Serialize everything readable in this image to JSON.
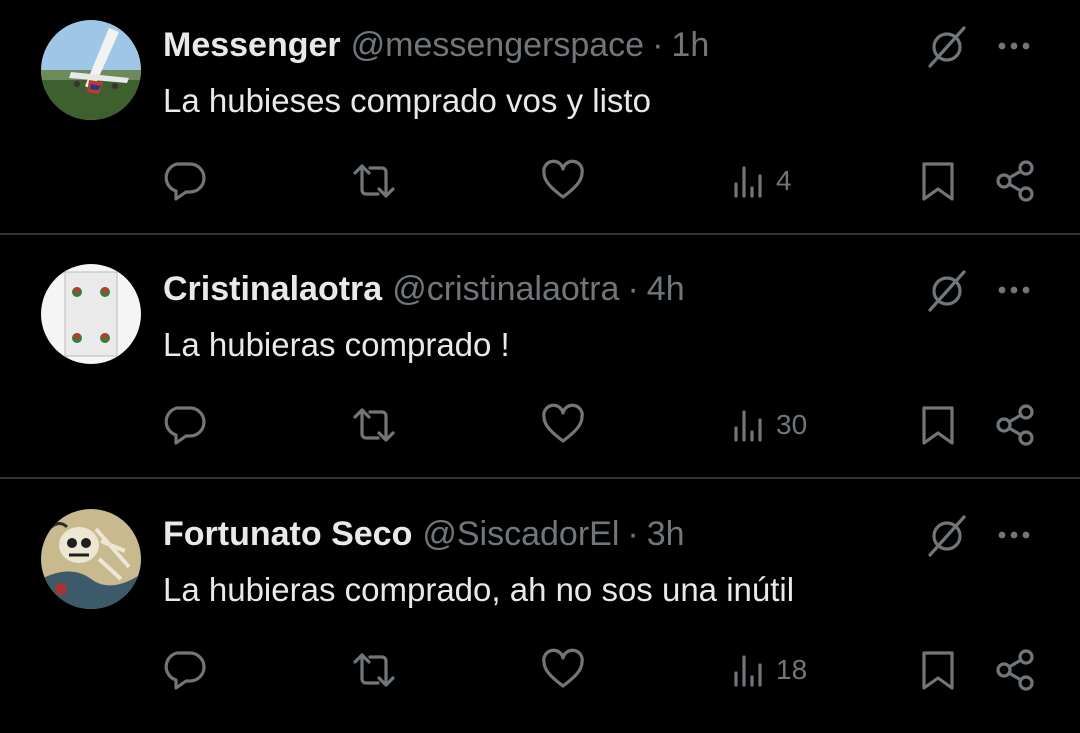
{
  "tweets": [
    {
      "name": "Messenger",
      "handle": "@messengerspace",
      "separator": "·",
      "time": "1h",
      "text": "La hubieses comprado vos y listo",
      "views": "4",
      "avatar": "airplane-photo"
    },
    {
      "name": "Cristinalaotra",
      "handle": "@cristinalaotra",
      "separator": "·",
      "time": "4h",
      "text": "La hubieras comprado !",
      "views": "30",
      "avatar": "playing-card"
    },
    {
      "name": "Fortunato Seco",
      "handle": "@SiscadorEl",
      "separator": "·",
      "time": "3h",
      "text": "La hubieras comprado, ah no sos una inútil",
      "views": "18",
      "avatar": "japanese-print-skeleton"
    }
  ],
  "icons": [
    "grok-icon",
    "more-icon",
    "reply-icon",
    "retweet-icon",
    "like-icon",
    "views-icon",
    "bookmark-icon",
    "share-icon"
  ],
  "colors": {
    "background": "#000000",
    "text": "#e7e9ea",
    "muted": "#71767b",
    "divider": "#2f3336"
  }
}
